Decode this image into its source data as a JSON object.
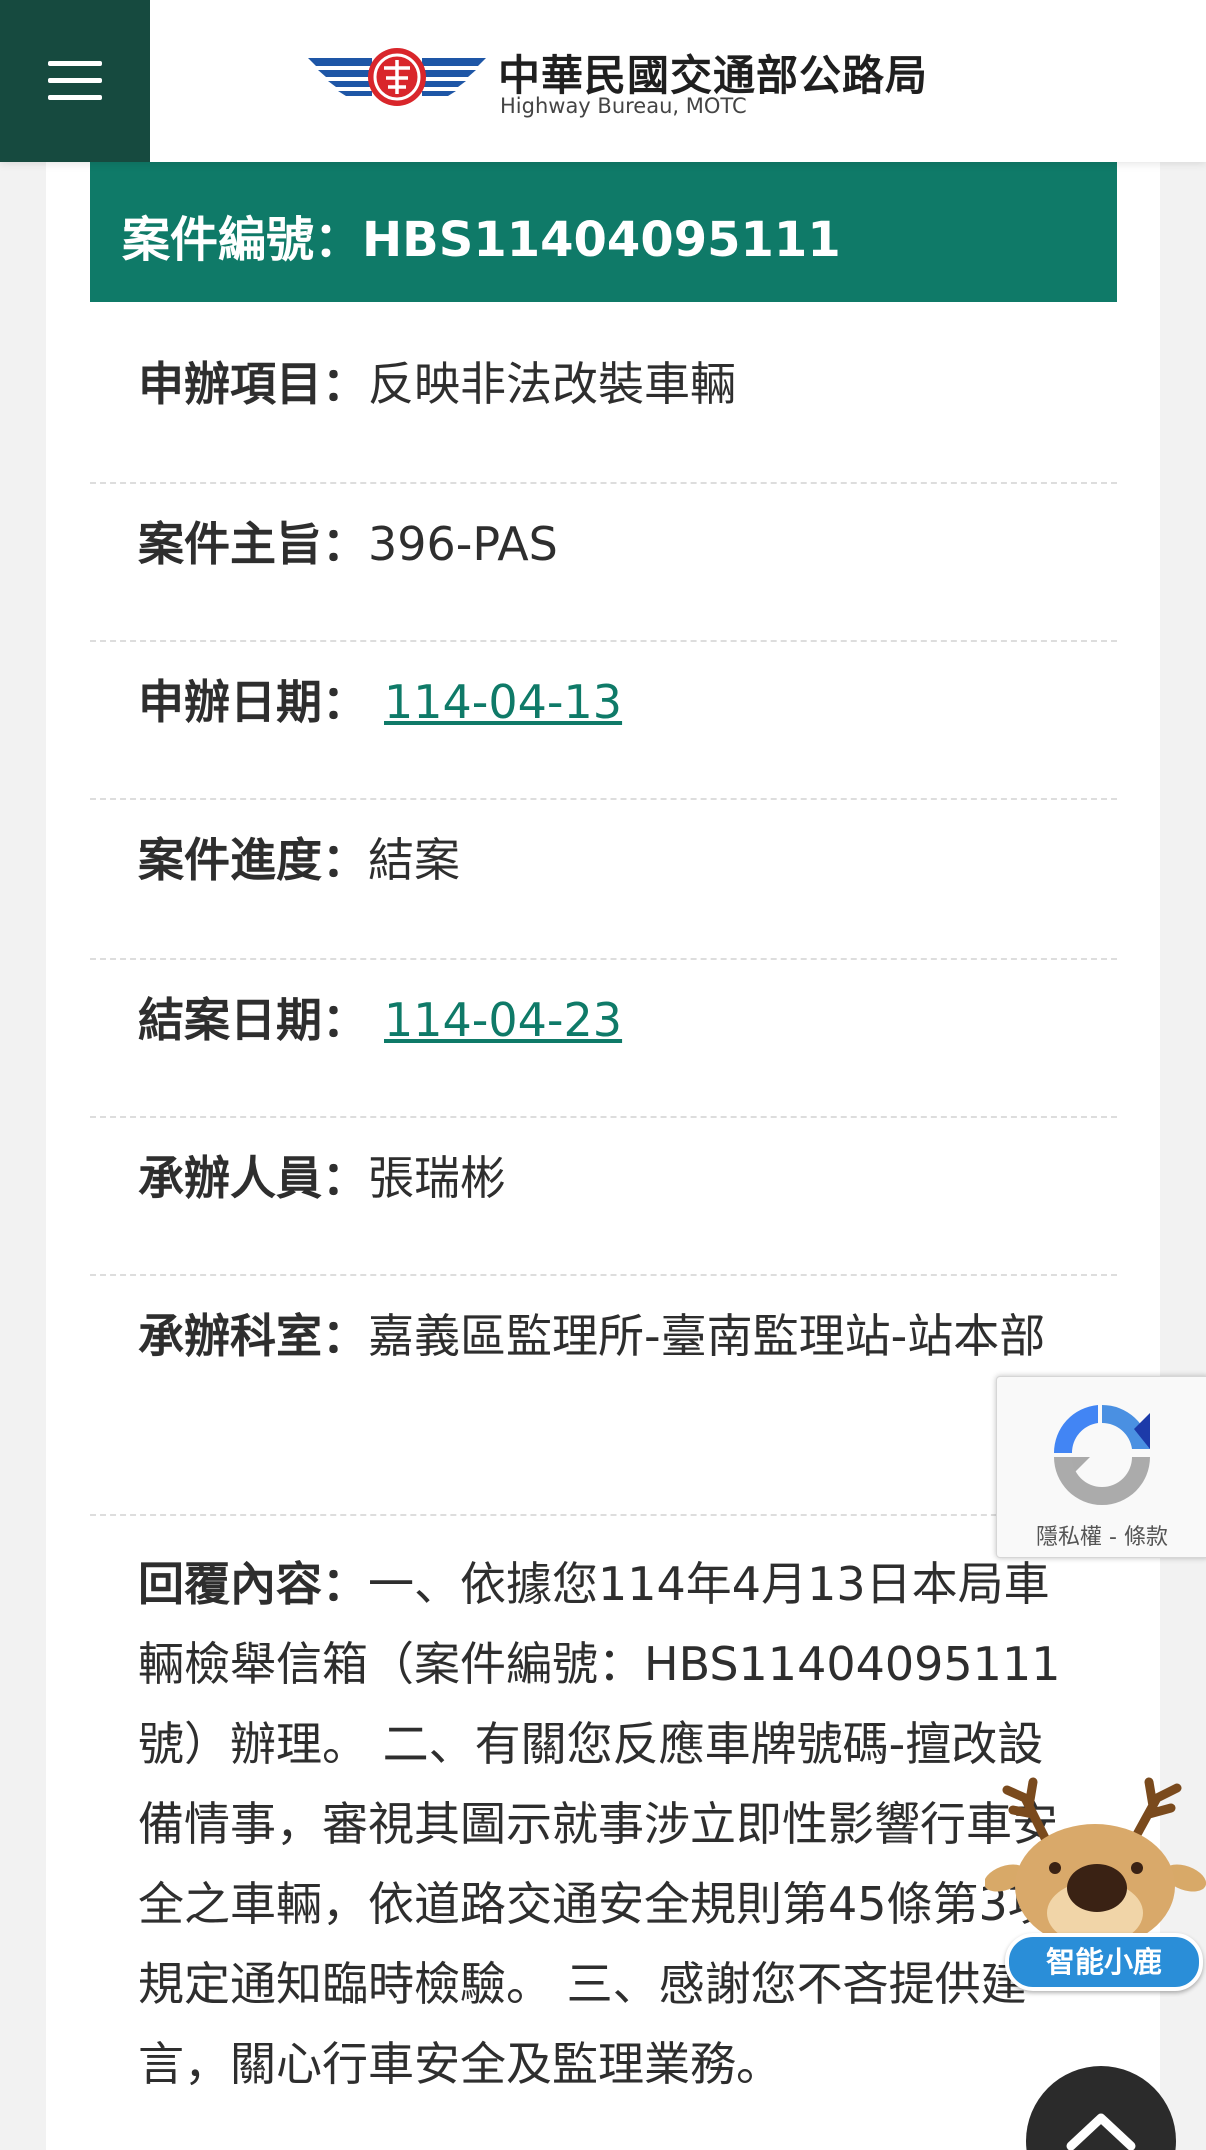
{
  "header": {
    "menu_icon": "hamburger-menu-icon",
    "logo_title": "中華民國交通部公路局",
    "logo_subtitle": "Highway Bureau, MOTC"
  },
  "case": {
    "title": "案件編號：HBS11404095111",
    "rows": [
      {
        "label": "申辦項目",
        "sep": "：",
        "value": "反映非法改裝車輛"
      },
      {
        "label": "案件主旨",
        "sep": "：",
        "value": "396-PAS"
      },
      {
        "label": "申辦日期",
        "sep": "：",
        "value": "114-04-13",
        "is_link": true
      },
      {
        "label": "案件進度",
        "sep": "：",
        "value": "結案"
      },
      {
        "label": "結案日期",
        "sep": "：",
        "value": "114-04-23",
        "is_link": true
      },
      {
        "label": "承辦人員",
        "sep": "：",
        "value": "張瑞彬"
      },
      {
        "label": "承辦科室",
        "sep": "：",
        "value": "嘉義區監理所-臺南監理站-站本部"
      },
      {
        "label": "回覆內容",
        "sep": "：",
        "value": "一、依據您114年4月13日本局車輛檢舉信箱（案件編號：HBS11404095111號）辦理。 二、有關您反應車牌號碼-擅改設備情事，審視其圖示就事涉立即性影響行車安全之車輛，依道路交通安全規則第45條第3項規定通知臨時檢驗。 三、感謝您不吝提供建言，關心行車安全及監理業務。"
      }
    ]
  },
  "recaptcha": {
    "icon": "recaptcha-icon",
    "links": "隱私權 - 條款"
  },
  "mascot": {
    "label": "智能小鹿",
    "icon": "deer-mascot-icon"
  },
  "back_to_top": {
    "icon": "chevron-up-icon"
  },
  "colors": {
    "header_dark": "#164a3f",
    "accent": "#0f7a68",
    "text": "#2e2e2e"
  }
}
